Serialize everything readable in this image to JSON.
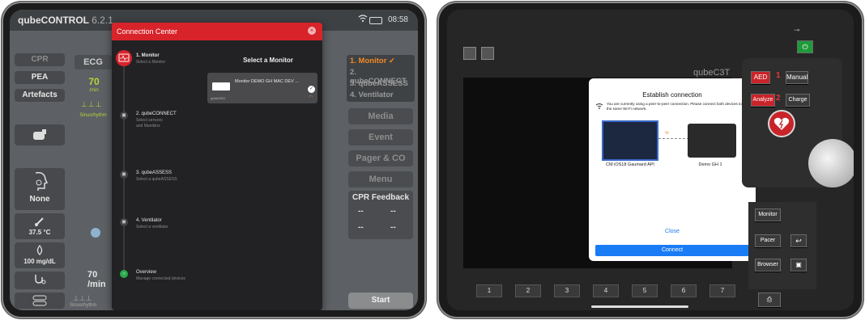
{
  "left": {
    "app_title": "qubeCONTROL",
    "version": "6.2.1",
    "status_time": "08:58",
    "left_buttons": [
      "CPR",
      "PEA",
      "Artefacts",
      "None",
      "37.5 °C",
      "100 mg/dL"
    ],
    "ecg_label": "ECG",
    "hr_value": "70",
    "hr_unit": "/min",
    "rhythm": "Sinusrhythm",
    "hr2_value": "70",
    "hr2_unit": "/min",
    "rhythm2": "Sinusrhythm",
    "right_steps": [
      "1. Monitor ✓",
      "2. qubeCONNECT",
      "3. qubeASSESS",
      "4. Ventilator"
    ],
    "right_buttons": [
      "Media",
      "Event",
      "Pager & CO",
      "Menu"
    ],
    "cpr_feedback": "CPR Feedback",
    "cpr_values": [
      "--",
      "--",
      "--",
      "--"
    ],
    "start_label": "Start",
    "modal": {
      "title": "Connection Center",
      "steps": [
        {
          "title": "1. Monitor",
          "sub": "Select a Monitor"
        },
        {
          "title": "2. qubeCONNECT",
          "sub": "Select sensors\nand Manikins"
        },
        {
          "title": "3. qubeASSESS",
          "sub": "Select a qubeASSESS"
        },
        {
          "title": "4. Ventilator",
          "sub": "Select a ventilator"
        },
        {
          "title": "Overview",
          "sub": "Manage connected devices"
        }
      ],
      "select_heading": "Select a Monitor",
      "device_name": "Monitor DEMO GH MAC DEV ...",
      "device_logo": "qubeDISC"
    }
  },
  "right": {
    "brand": "qubeC3T",
    "buttons": {
      "aed": "AED",
      "manual": "Manual",
      "analyze": "Analyze",
      "charge": "Charge",
      "monitor": "Monitor",
      "pacer": "Pacer",
      "browser": "Browser"
    },
    "step_numbers": [
      "1",
      "2"
    ],
    "softkeys": [
      "1",
      "2",
      "3",
      "4",
      "5",
      "6",
      "7"
    ],
    "dialog": {
      "title": "Establish connection",
      "message": "You are currently using a peer-to-peer connection. Please connect both devices to the same Wi-Fi network.",
      "device_a": "CM iOS18 Gaumard API",
      "device_b": "Demo GH 1",
      "close_label": "Close",
      "connect_label": "Connect"
    },
    "colors": {
      "accent_blue": "#1a7cf5",
      "red": "#c8242a",
      "green": "#1f9a3a"
    }
  }
}
